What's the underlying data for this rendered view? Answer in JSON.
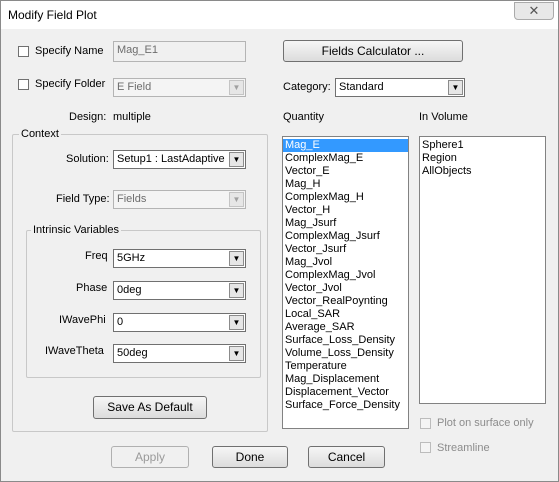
{
  "window": {
    "title": "Modify Field Plot",
    "close_glyph": "✕"
  },
  "specify_name": {
    "label": "Specify Name",
    "checked": false,
    "value": "Mag_E1"
  },
  "specify_folder": {
    "label": "Specify Folder",
    "checked": false,
    "value": "E Field"
  },
  "design": {
    "label": "Design:",
    "value": "multiple"
  },
  "fields_calculator": {
    "label": "Fields Calculator ..."
  },
  "category": {
    "label": "Category:",
    "value": "Standard"
  },
  "context": {
    "title": "Context",
    "solution": {
      "label": "Solution:",
      "value": "Setup1 : LastAdaptive"
    },
    "field_type": {
      "label": "Field Type:",
      "value": "Fields"
    }
  },
  "intrinsic": {
    "title": "Intrinsic Variables",
    "rows": [
      {
        "label": "Freq",
        "value": "5GHz"
      },
      {
        "label": "Phase",
        "value": "0deg"
      },
      {
        "label": "IWavePhi",
        "value": "0"
      },
      {
        "label": "IWaveTheta",
        "value": "50deg"
      }
    ]
  },
  "save_default": {
    "label": "Save As Default"
  },
  "quantity": {
    "title": "Quantity",
    "selected_index": 0,
    "items": [
      "Mag_E",
      "ComplexMag_E",
      "Vector_E",
      "Mag_H",
      "ComplexMag_H",
      "Vector_H",
      "Mag_Jsurf",
      "ComplexMag_Jsurf",
      "Vector_Jsurf",
      "Mag_Jvol",
      "ComplexMag_Jvol",
      "Vector_Jvol",
      "Vector_RealPoynting",
      "Local_SAR",
      "Average_SAR",
      "Surface_Loss_Density",
      "Volume_Loss_Density",
      "Temperature",
      "Mag_Displacement",
      "Displacement_Vector",
      "Surface_Force_Density"
    ]
  },
  "in_volume": {
    "title": "In Volume",
    "items": [
      "Sphere1",
      "Region",
      "AllObjects"
    ]
  },
  "plot_on_surface": {
    "label": "Plot on surface only",
    "checked": false
  },
  "streamline": {
    "label": "Streamline",
    "checked": false
  },
  "buttons": {
    "apply": "Apply",
    "done": "Done",
    "cancel": "Cancel"
  }
}
